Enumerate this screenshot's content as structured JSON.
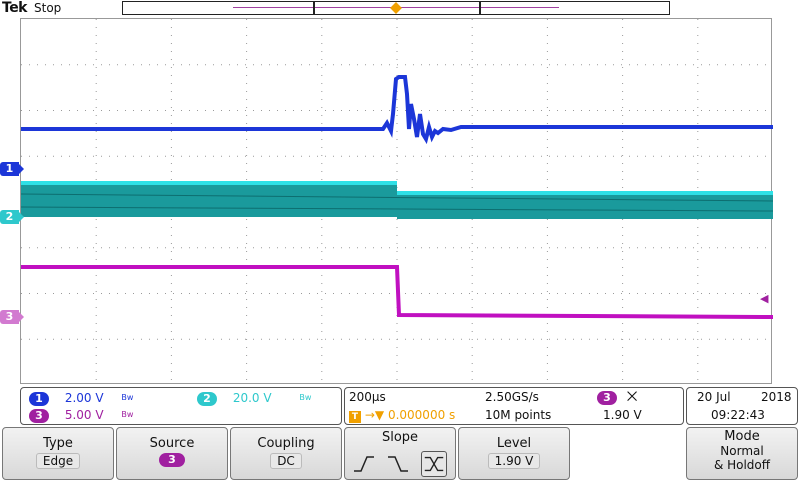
{
  "top": {
    "brand": "Tek",
    "status": "Stop"
  },
  "markers": {
    "trigger_top": "T",
    "ch1": "1",
    "ch2": "2",
    "ch3": "3"
  },
  "channels": [
    {
      "num": "1",
      "scale": "2.00 V",
      "bw": "Bᴡ",
      "color": "#1c36d8"
    },
    {
      "num": "2",
      "scale": "20.0 V",
      "bw": "Bᴡ",
      "color": "#2ec8cc"
    },
    {
      "num": "3",
      "scale": "5.00 V",
      "bw": "Bᴡ",
      "color": "#a020a0"
    }
  ],
  "timebase": {
    "scale": "200µs",
    "sample_rate": "2.50GS/s",
    "trigger_position": "0.000000 s",
    "record_length": "10M points",
    "trigger_source": "3",
    "trigger_level": "1.90 V"
  },
  "datetime": {
    "date": "20 Jul",
    "year": "2018",
    "time": "09:22:43"
  },
  "menu": {
    "type_title": "Type",
    "type_value": "Edge",
    "source_title": "Source",
    "source_value": "3",
    "coupling_title": "Coupling",
    "coupling_value": "DC",
    "slope_title": "Slope",
    "level_title": "Level",
    "level_value": "1.90 V",
    "mode_title": "Mode",
    "mode_value1": "Normal",
    "mode_value2": "& Holdoff"
  },
  "colors": {
    "ch1": "#1c36d8",
    "ch2": "#2ec8cc",
    "ch3": "#a020a0",
    "trigger": "#f0a000"
  }
}
